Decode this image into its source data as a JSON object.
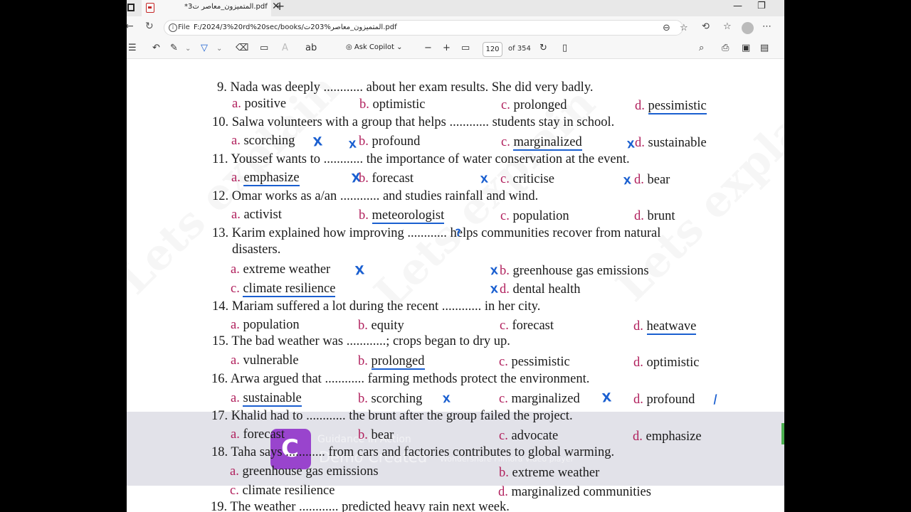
{
  "browser": {
    "tab_title": "*المتميزون_معاصر ت3.pdf",
    "tab_close": "✕",
    "new_tab": "+",
    "address_label": "File",
    "url": "F:/2024/3%20rd%20sec/books/المتميزون_معاصر%203ت.pdf",
    "window_controls": [
      "—",
      "❐",
      "✕"
    ]
  },
  "pdf_toolbar": {
    "copilot_label": "Ask Copilot",
    "page_current": "120",
    "page_total": "of 354"
  },
  "questions": [
    {
      "num": "9.",
      "text": "Nada was deeply ............ about her exam results. She did very badly.",
      "options": [
        {
          "letter": "a.",
          "text": "positive"
        },
        {
          "letter": "b.",
          "text": "optimistic"
        },
        {
          "letter": "c.",
          "text": "prolonged"
        },
        {
          "letter": "d.",
          "text": "pessimistic"
        }
      ]
    },
    {
      "num": "10.",
      "text": "Salwa volunteers with a group that helps ............ students stay in school.",
      "options": [
        {
          "letter": "a.",
          "text": "scorching"
        },
        {
          "letter": "b.",
          "text": "profound"
        },
        {
          "letter": "c.",
          "text": "marginalized"
        },
        {
          "letter": "d.",
          "text": "sustainable"
        }
      ]
    },
    {
      "num": "11.",
      "text": "Youssef wants to ............ the importance of water conservation at the event.",
      "options": [
        {
          "letter": "a.",
          "text": "emphasize"
        },
        {
          "letter": "b.",
          "text": "forecast"
        },
        {
          "letter": "c.",
          "text": "criticise"
        },
        {
          "letter": "d.",
          "text": "bear"
        }
      ]
    },
    {
      "num": "12.",
      "text": "Omar works as a/an ............ and studies rainfall and wind.",
      "options": [
        {
          "letter": "a.",
          "text": "activist"
        },
        {
          "letter": "b.",
          "text": "meteorologist"
        },
        {
          "letter": "c.",
          "text": "population"
        },
        {
          "letter": "d.",
          "text": "brunt"
        }
      ]
    },
    {
      "num": "13.",
      "text": "Karim explained how improving ............ helps communities recover from natural",
      "text2": "disasters.",
      "options": [
        {
          "letter": "a.",
          "text": "extreme weather"
        },
        {
          "letter": "b.",
          "text": "greenhouse gas emissions"
        },
        {
          "letter": "c.",
          "text": "climate resilience"
        },
        {
          "letter": "d.",
          "text": "dental health"
        }
      ]
    },
    {
      "num": "14.",
      "text": "Mariam suffered a lot during the recent ............ in her city.",
      "options": [
        {
          "letter": "a.",
          "text": "population"
        },
        {
          "letter": "b.",
          "text": "equity"
        },
        {
          "letter": "c.",
          "text": "forecast"
        },
        {
          "letter": "d.",
          "text": "heatwave"
        }
      ]
    },
    {
      "num": "15.",
      "text": "The bad weather was ............; crops began to dry up.",
      "options": [
        {
          "letter": "a.",
          "text": "vulnerable"
        },
        {
          "letter": "b.",
          "text": "prolonged"
        },
        {
          "letter": "c.",
          "text": "pessimistic"
        },
        {
          "letter": "d.",
          "text": "optimistic"
        }
      ]
    },
    {
      "num": "16.",
      "text": "Arwa argued that ............ farming methods protect the environment.",
      "options": [
        {
          "letter": "a.",
          "text": "sustainable"
        },
        {
          "letter": "b.",
          "text": "scorching"
        },
        {
          "letter": "c.",
          "text": "marginalized"
        },
        {
          "letter": "d.",
          "text": "profound"
        }
      ]
    },
    {
      "num": "17.",
      "text": "Khalid had to ............ the brunt after the group failed the project.",
      "options": [
        {
          "letter": "a.",
          "text": "forecast"
        },
        {
          "letter": "b.",
          "text": "bear"
        },
        {
          "letter": "c.",
          "text": "advocate"
        },
        {
          "letter": "d.",
          "text": "emphasize"
        }
      ]
    },
    {
      "num": "18.",
      "text": "Taha says ............ from cars and factories contributes to global warming.",
      "options": [
        {
          "letter": "a.",
          "text": "greenhouse gas emissions"
        },
        {
          "letter": "b.",
          "text": "extreme weather"
        },
        {
          "letter": "c.",
          "text": "climate resilience"
        },
        {
          "letter": "d.",
          "text": "marginalized communities"
        }
      ]
    },
    {
      "num": "19.",
      "text": "The weather ............ predicted heavy rain next week."
    }
  ],
  "annotations": {
    "cross": "X",
    "question": "?",
    "check": "/"
  },
  "overlay": {
    "line1": "Guidance in Action",
    "line2": "Demo Created",
    "line3": "Wondershare Filmora video player"
  },
  "watermark": "Lets explain"
}
